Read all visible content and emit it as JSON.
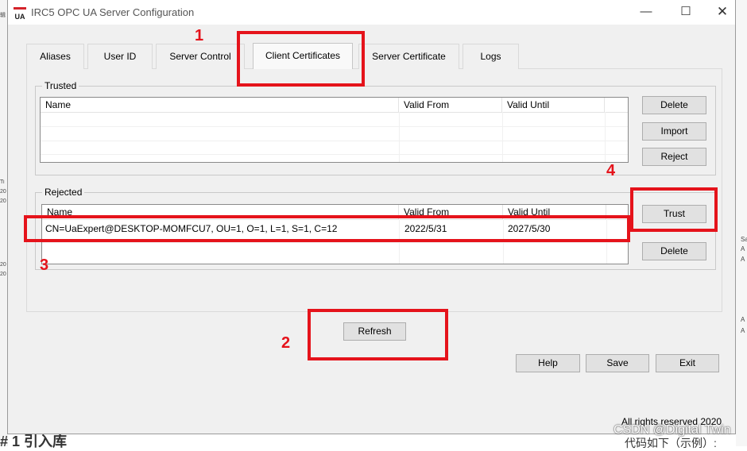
{
  "window": {
    "app_icon_text": "UA",
    "title": "IRC5 OPC UA Server Configuration",
    "controls": {
      "minimize": "—",
      "maximize": "☐",
      "close": "✕"
    }
  },
  "tabs": [
    {
      "label": "Aliases",
      "active": false
    },
    {
      "label": "User ID",
      "active": false
    },
    {
      "label": "Server Control",
      "active": false
    },
    {
      "label": "Client Certificates",
      "active": true
    },
    {
      "label": "Server Certificate",
      "active": false
    },
    {
      "label": "Logs",
      "active": false
    }
  ],
  "trusted": {
    "label": "Trusted",
    "columns": [
      "Name",
      "Valid From",
      "Valid Until"
    ],
    "rows": [],
    "buttons": {
      "delete": "Delete",
      "import": "Import",
      "reject": "Reject"
    }
  },
  "rejected": {
    "label": "Rejected",
    "columns": [
      "Name",
      "Valid From",
      "Valid Until"
    ],
    "rows": [
      {
        "name": "CN=UaExpert@DESKTOP-MOMFCU7, OU=1, O=1, L=1, S=1, C=12",
        "valid_from": "2022/5/31",
        "valid_until": "2027/5/30"
      }
    ],
    "buttons": {
      "trust": "Trust",
      "delete": "Delete"
    }
  },
  "actions": {
    "refresh": "Refresh",
    "help": "Help",
    "save": "Save",
    "exit": "Exit"
  },
  "footer": {
    "copyright": "All rights reserved 2020"
  },
  "annotations": {
    "n1": "1",
    "n2": "2",
    "n3": "3",
    "n4": "4",
    "color": "#e5131b"
  },
  "watermark": "CSDN @Digital Twin",
  "background": {
    "left_marks": [
      "辑",
      "Ti",
      "20",
      "20",
      "20",
      "20"
    ],
    "right_marks": [
      "Sa",
      "A",
      "A",
      "A",
      "A"
    ],
    "bottom_left": "# 1 引入库",
    "bottom_right": "代码如下（示例）:"
  }
}
